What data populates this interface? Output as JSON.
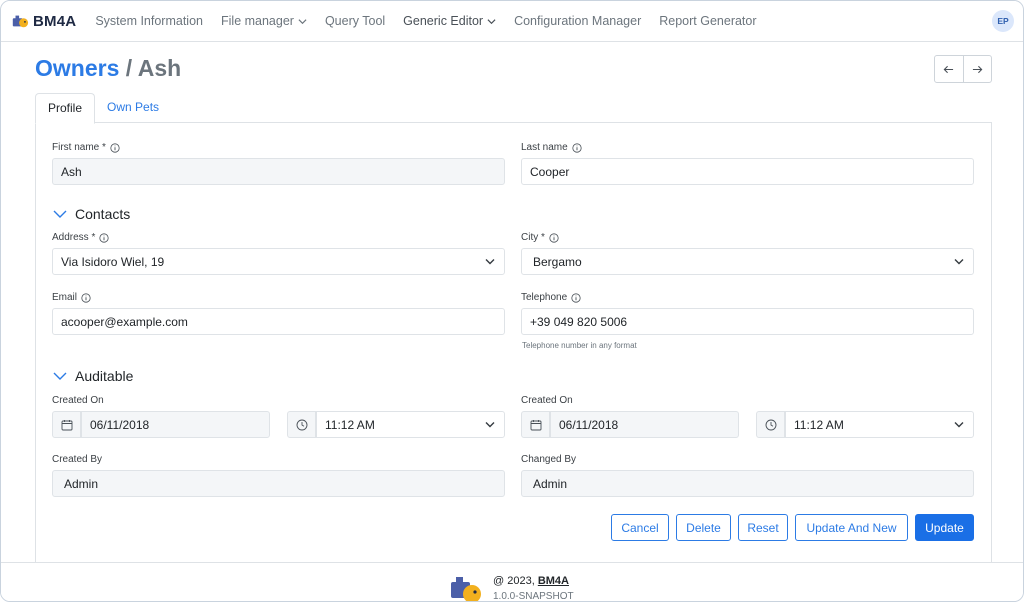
{
  "navbar": {
    "brand": "BM4A",
    "items": [
      {
        "label": "System Information",
        "dropdown": false
      },
      {
        "label": "File manager",
        "dropdown": true
      },
      {
        "label": "Query Tool",
        "dropdown": false
      },
      {
        "label": "Generic Editor",
        "dropdown": true
      },
      {
        "label": "Configuration Manager",
        "dropdown": false
      },
      {
        "label": "Report Generator",
        "dropdown": false
      }
    ],
    "avatar_initials": "EP"
  },
  "header": {
    "title_entity": "Owners",
    "title_separator": "/",
    "title_record": "Ash",
    "prev_icon": "arrow-left-icon",
    "next_icon": "arrow-right-icon"
  },
  "tabs": [
    {
      "label": "Profile",
      "active": true
    },
    {
      "label": "Own Pets",
      "active": false
    }
  ],
  "form": {
    "first_name": {
      "label": "First name *",
      "value": "Ash"
    },
    "last_name": {
      "label": "Last name",
      "value": "Cooper"
    },
    "contacts_section": "Contacts",
    "address": {
      "label": "Address *",
      "value": "Via Isidoro Wiel, 19"
    },
    "city": {
      "label": "City *",
      "value": "Bergamo"
    },
    "email": {
      "label": "Email",
      "value": "acooper@example.com"
    },
    "telephone": {
      "label": "Telephone",
      "value": "+39 049 820 5006",
      "hint": "Telephone number in any format"
    },
    "auditable_section": "Auditable",
    "created_on_1": {
      "label": "Created On",
      "date": "06/11/2018",
      "time": "11:12 AM"
    },
    "created_on_2": {
      "label": "Created On",
      "date": "06/11/2018",
      "time": "11:12 AM"
    },
    "created_by": {
      "label": "Created By",
      "value": "Admin"
    },
    "changed_by": {
      "label": "Changed By",
      "value": "Admin"
    }
  },
  "actions": {
    "cancel": "Cancel",
    "delete": "Delete",
    "reset": "Reset",
    "update_and_new": "Update And New",
    "update": "Update"
  },
  "footer": {
    "copyright_prefix": "@ 2023,",
    "brand": "BM4A",
    "version": "1.0.0-SNAPSHOT"
  },
  "colors": {
    "accent": "#2c7be5",
    "primary_button": "#1a6fe6",
    "readonly_bg": "#f4f6f8"
  }
}
